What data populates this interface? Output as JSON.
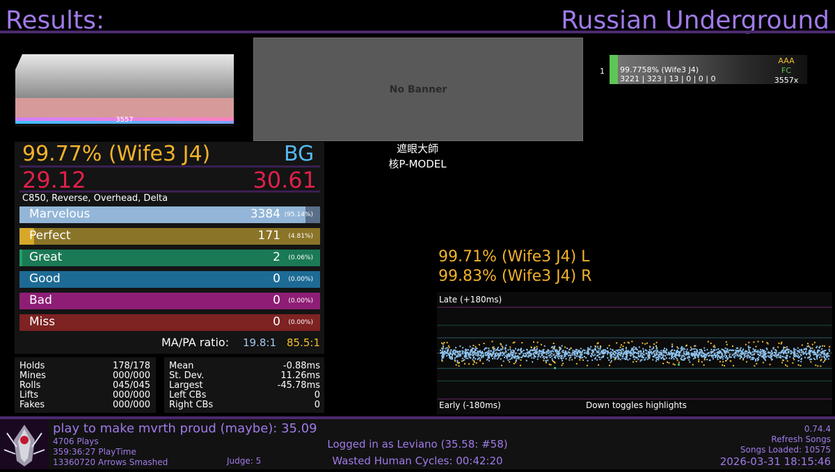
{
  "header": {
    "title": "Results:",
    "song": "Russian Underground"
  },
  "lifegraph": {
    "combo_label": "3557"
  },
  "banner": {
    "text": "No Banner"
  },
  "artist": {
    "subtitle": "遮眼大師",
    "artist": "核P-MODEL"
  },
  "scoreboard": {
    "rank": "1",
    "line1": "99.7758% (Wife3 J4)",
    "line2": "3221 | 323 | 13 | 0 | 0 | 0",
    "grade": "AAA",
    "clear": "FC",
    "combo": "3557x"
  },
  "score": {
    "percent": "99.77% (Wife3 J4)",
    "grade": "BG",
    "ssr_left": "29.12",
    "ssr_right": "30.61",
    "mods": "C850, Reverse, Overhead, Delta"
  },
  "judgments": [
    {
      "label": "Marvelous",
      "count": "3384",
      "pct": "(95.14%)",
      "fraction": 0.9514,
      "color": "#93b6d8",
      "track": "#5a6f8a",
      "count_color": "#ffffff"
    },
    {
      "label": "Perfect",
      "count": "171",
      "pct": "(4.81%)",
      "fraction": 0.0481,
      "color": "#d6a82a",
      "track": "#8a7428",
      "count_color": "#ffffff"
    },
    {
      "label": "Great",
      "count": "2",
      "pct": "(0.06%)",
      "fraction": 0.0006,
      "color": "#22a066",
      "track": "#1a7a55",
      "count_color": "#ffffff"
    },
    {
      "label": "Good",
      "count": "0",
      "pct": "(0.00%)",
      "fraction": 0,
      "color": "#2a86b8",
      "track": "#1d6b95",
      "count_color": "#ffffff"
    },
    {
      "label": "Bad",
      "count": "0",
      "pct": "(0.00%)",
      "fraction": 0,
      "color": "#b02a90",
      "track": "#8e1e75",
      "count_color": "#ffffff"
    },
    {
      "label": "Miss",
      "count": "0",
      "pct": "(0.00%)",
      "fraction": 0,
      "color": "#a82a2a",
      "track": "#7e2222",
      "count_color": "#ffffff"
    }
  ],
  "ratios": {
    "label": "MA/PA ratio:",
    "ma": "19.8:1",
    "pa": "85.5:1"
  },
  "stats_left": [
    {
      "label": "Holds",
      "value": "178/178"
    },
    {
      "label": "Mines",
      "value": "000/000"
    },
    {
      "label": "Rolls",
      "value": "045/045"
    },
    {
      "label": "Lifts",
      "value": "000/000"
    },
    {
      "label": "Fakes",
      "value": "000/000"
    }
  ],
  "stats_right": [
    {
      "label": "Mean",
      "value": "-0.88ms"
    },
    {
      "label": "St. Dev.",
      "value": "11.26ms"
    },
    {
      "label": "Largest",
      "value": "-45.78ms"
    },
    {
      "label": "Left CBs",
      "value": "0"
    },
    {
      "label": "Right CBs",
      "value": "0"
    }
  ],
  "offset": {
    "left_score": "99.71% (Wife3 J4) L",
    "right_score": "99.83% (Wife3 J4) R",
    "late_label": "Late (+180ms)",
    "early_label": "Early (-180ms)",
    "hint": "Down toggles highlights"
  },
  "footer": {
    "profile_line": "play to make mvrth proud (maybe): 35.09",
    "plays": "4706 Plays",
    "playtime": "359:36:27 PlayTime",
    "arrows": "13360720 Arrows Smashed",
    "judge": "Judge: 5",
    "login": "Logged in as Leviano (35.58: #58)",
    "session": "Wasted Human Cycles: 00:42:20",
    "version": "0.74.4",
    "refresh": "Refresh Songs",
    "songs_loaded": "Songs Loaded: 10575",
    "datetime": "2026-03-31 18:15:46"
  }
}
